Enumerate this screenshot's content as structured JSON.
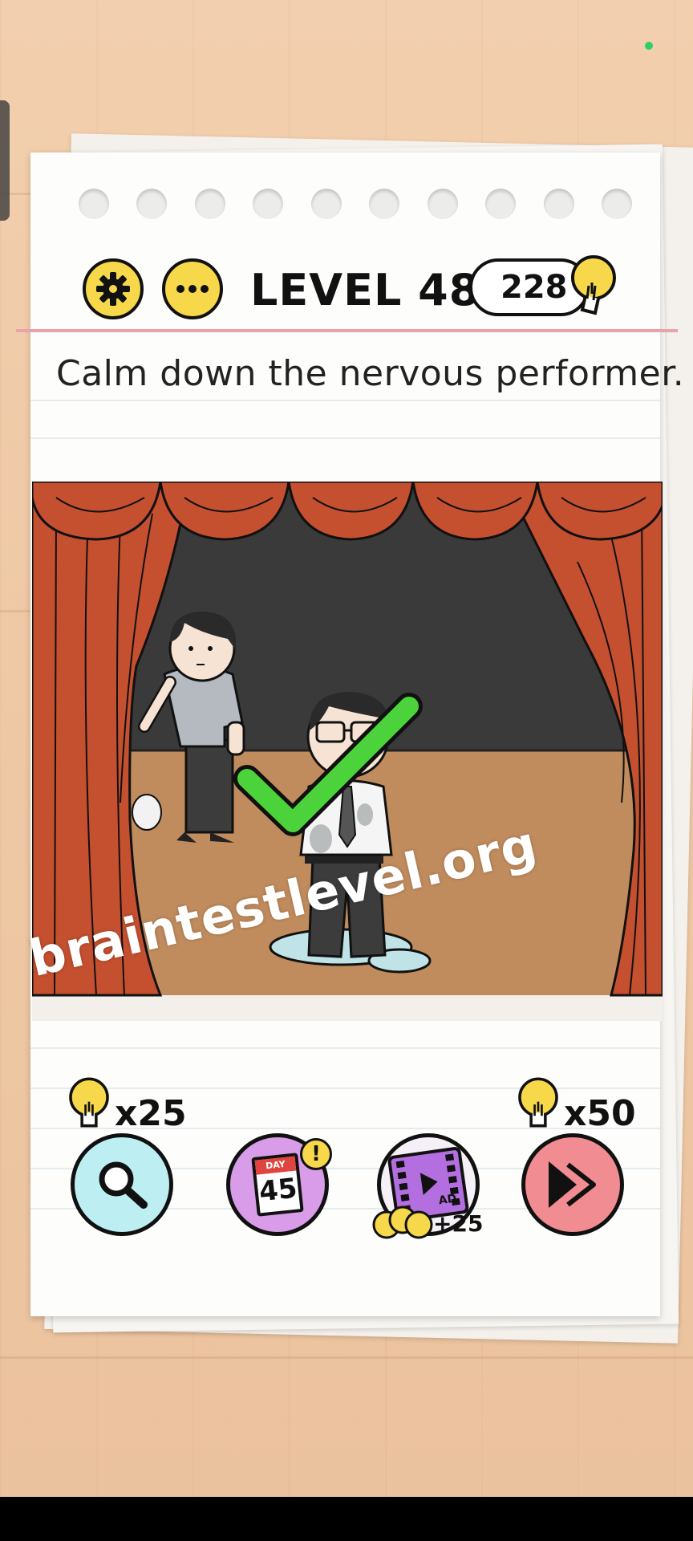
{
  "header": {
    "level_label": "LEVEL 480",
    "hint_count": "228",
    "settings_icon": "gear-icon",
    "more_icon": "more-dots-icon",
    "hint_icon": "lightbulb-icon"
  },
  "instruction": "Calm down the nervous performer.",
  "scene": {
    "result_icon": "green-checkmark-icon"
  },
  "watermark": "braintestlevel.org",
  "toolbar": {
    "hint_cost": "x25",
    "skip_cost": "x50",
    "daily_day_label": "DAY",
    "daily_day_number": "45",
    "daily_badge": "!",
    "ad_label": "AD",
    "ad_reward": "+25"
  },
  "colors": {
    "accent_yellow": "#f7d84a",
    "curtain_red": "#c4502f",
    "stage_floor": "#c08c5e",
    "check_green": "#4cd23a",
    "hint_button_bg": "#bdeff2",
    "daily_button_bg": "#d89ce8",
    "skip_button_bg": "#f08c92"
  }
}
